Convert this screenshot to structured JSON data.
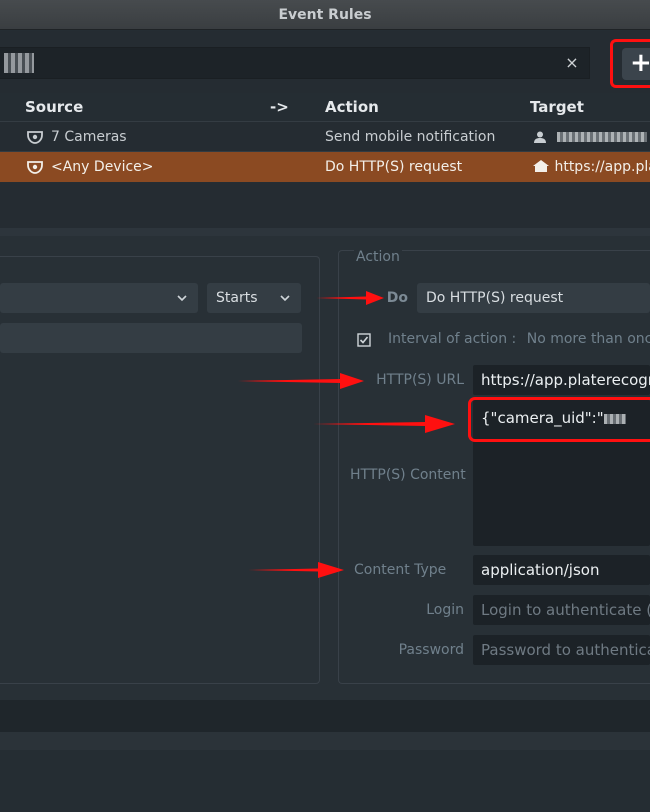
{
  "window": {
    "title": "Event Rules"
  },
  "search": {
    "clear_symbol": "×"
  },
  "toolbar": {
    "add_symbol": "+"
  },
  "table": {
    "headers": [
      "Source",
      "->",
      "Action",
      "Target"
    ],
    "rows": [
      {
        "source": "7 Cameras",
        "action": "Send mobile notification",
        "target": "",
        "selected": false
      },
      {
        "source": "<Any Device>",
        "action": "Do HTTP(S) request",
        "target": "https://app.pla",
        "selected": true
      }
    ]
  },
  "event_panel": {
    "state_select": "Starts"
  },
  "action_panel": {
    "section_title": "Action",
    "do_label": "Do",
    "do_value": "Do HTTP(S) request",
    "interval_label": "Interval of action :",
    "interval_value": "No more than once pe",
    "url_label": "HTTP(S) URL",
    "url_value": "https://app.platerecogniz",
    "content_label": "HTTP(S) Content",
    "content_value": "{\"camera_uid\":\"",
    "content_type_label": "Content Type",
    "content_type_value": "application/json",
    "login_label": "Login",
    "login_placeholder": "Login to authenticate (op",
    "password_label": "Password",
    "password_placeholder": "Password to authenticate"
  },
  "colors": {
    "accent_selected_row": "#8b4a22",
    "highlight_red": "#ff1010",
    "background": "#252d33"
  },
  "icons": {
    "camera": "camera-icon",
    "user": "user-icon",
    "home": "home-icon",
    "checkbox": "checkbox-checked-icon",
    "chevron": "chevron-down-icon"
  }
}
